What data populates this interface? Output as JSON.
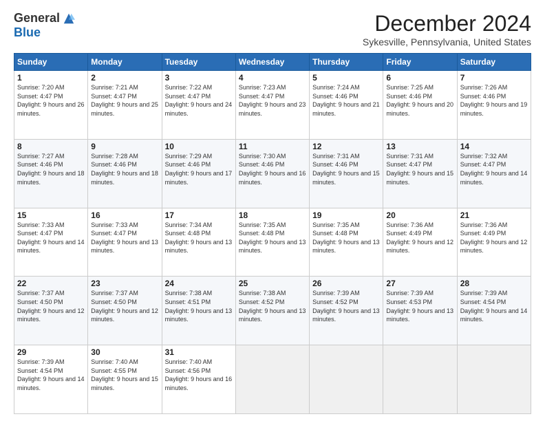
{
  "logo": {
    "general": "General",
    "blue": "Blue"
  },
  "title": "December 2024",
  "location": "Sykesville, Pennsylvania, United States",
  "days_of_week": [
    "Sunday",
    "Monday",
    "Tuesday",
    "Wednesday",
    "Thursday",
    "Friday",
    "Saturday"
  ],
  "weeks": [
    [
      {
        "day": "1",
        "sunrise": "7:20 AM",
        "sunset": "4:47 PM",
        "daylight": "9 hours and 26 minutes."
      },
      {
        "day": "2",
        "sunrise": "7:21 AM",
        "sunset": "4:47 PM",
        "daylight": "9 hours and 25 minutes."
      },
      {
        "day": "3",
        "sunrise": "7:22 AM",
        "sunset": "4:47 PM",
        "daylight": "9 hours and 24 minutes."
      },
      {
        "day": "4",
        "sunrise": "7:23 AM",
        "sunset": "4:47 PM",
        "daylight": "9 hours and 23 minutes."
      },
      {
        "day": "5",
        "sunrise": "7:24 AM",
        "sunset": "4:46 PM",
        "daylight": "9 hours and 21 minutes."
      },
      {
        "day": "6",
        "sunrise": "7:25 AM",
        "sunset": "4:46 PM",
        "daylight": "9 hours and 20 minutes."
      },
      {
        "day": "7",
        "sunrise": "7:26 AM",
        "sunset": "4:46 PM",
        "daylight": "9 hours and 19 minutes."
      }
    ],
    [
      {
        "day": "8",
        "sunrise": "7:27 AM",
        "sunset": "4:46 PM",
        "daylight": "9 hours and 18 minutes."
      },
      {
        "day": "9",
        "sunrise": "7:28 AM",
        "sunset": "4:46 PM",
        "daylight": "9 hours and 18 minutes."
      },
      {
        "day": "10",
        "sunrise": "7:29 AM",
        "sunset": "4:46 PM",
        "daylight": "9 hours and 17 minutes."
      },
      {
        "day": "11",
        "sunrise": "7:30 AM",
        "sunset": "4:46 PM",
        "daylight": "9 hours and 16 minutes."
      },
      {
        "day": "12",
        "sunrise": "7:31 AM",
        "sunset": "4:46 PM",
        "daylight": "9 hours and 15 minutes."
      },
      {
        "day": "13",
        "sunrise": "7:31 AM",
        "sunset": "4:47 PM",
        "daylight": "9 hours and 15 minutes."
      },
      {
        "day": "14",
        "sunrise": "7:32 AM",
        "sunset": "4:47 PM",
        "daylight": "9 hours and 14 minutes."
      }
    ],
    [
      {
        "day": "15",
        "sunrise": "7:33 AM",
        "sunset": "4:47 PM",
        "daylight": "9 hours and 14 minutes."
      },
      {
        "day": "16",
        "sunrise": "7:33 AM",
        "sunset": "4:47 PM",
        "daylight": "9 hours and 13 minutes."
      },
      {
        "day": "17",
        "sunrise": "7:34 AM",
        "sunset": "4:48 PM",
        "daylight": "9 hours and 13 minutes."
      },
      {
        "day": "18",
        "sunrise": "7:35 AM",
        "sunset": "4:48 PM",
        "daylight": "9 hours and 13 minutes."
      },
      {
        "day": "19",
        "sunrise": "7:35 AM",
        "sunset": "4:48 PM",
        "daylight": "9 hours and 13 minutes."
      },
      {
        "day": "20",
        "sunrise": "7:36 AM",
        "sunset": "4:49 PM",
        "daylight": "9 hours and 12 minutes."
      },
      {
        "day": "21",
        "sunrise": "7:36 AM",
        "sunset": "4:49 PM",
        "daylight": "9 hours and 12 minutes."
      }
    ],
    [
      {
        "day": "22",
        "sunrise": "7:37 AM",
        "sunset": "4:50 PM",
        "daylight": "9 hours and 12 minutes."
      },
      {
        "day": "23",
        "sunrise": "7:37 AM",
        "sunset": "4:50 PM",
        "daylight": "9 hours and 12 minutes."
      },
      {
        "day": "24",
        "sunrise": "7:38 AM",
        "sunset": "4:51 PM",
        "daylight": "9 hours and 13 minutes."
      },
      {
        "day": "25",
        "sunrise": "7:38 AM",
        "sunset": "4:52 PM",
        "daylight": "9 hours and 13 minutes."
      },
      {
        "day": "26",
        "sunrise": "7:39 AM",
        "sunset": "4:52 PM",
        "daylight": "9 hours and 13 minutes."
      },
      {
        "day": "27",
        "sunrise": "7:39 AM",
        "sunset": "4:53 PM",
        "daylight": "9 hours and 13 minutes."
      },
      {
        "day": "28",
        "sunrise": "7:39 AM",
        "sunset": "4:54 PM",
        "daylight": "9 hours and 14 minutes."
      }
    ],
    [
      {
        "day": "29",
        "sunrise": "7:39 AM",
        "sunset": "4:54 PM",
        "daylight": "9 hours and 14 minutes."
      },
      {
        "day": "30",
        "sunrise": "7:40 AM",
        "sunset": "4:55 PM",
        "daylight": "9 hours and 15 minutes."
      },
      {
        "day": "31",
        "sunrise": "7:40 AM",
        "sunset": "4:56 PM",
        "daylight": "9 hours and 16 minutes."
      },
      null,
      null,
      null,
      null
    ]
  ]
}
